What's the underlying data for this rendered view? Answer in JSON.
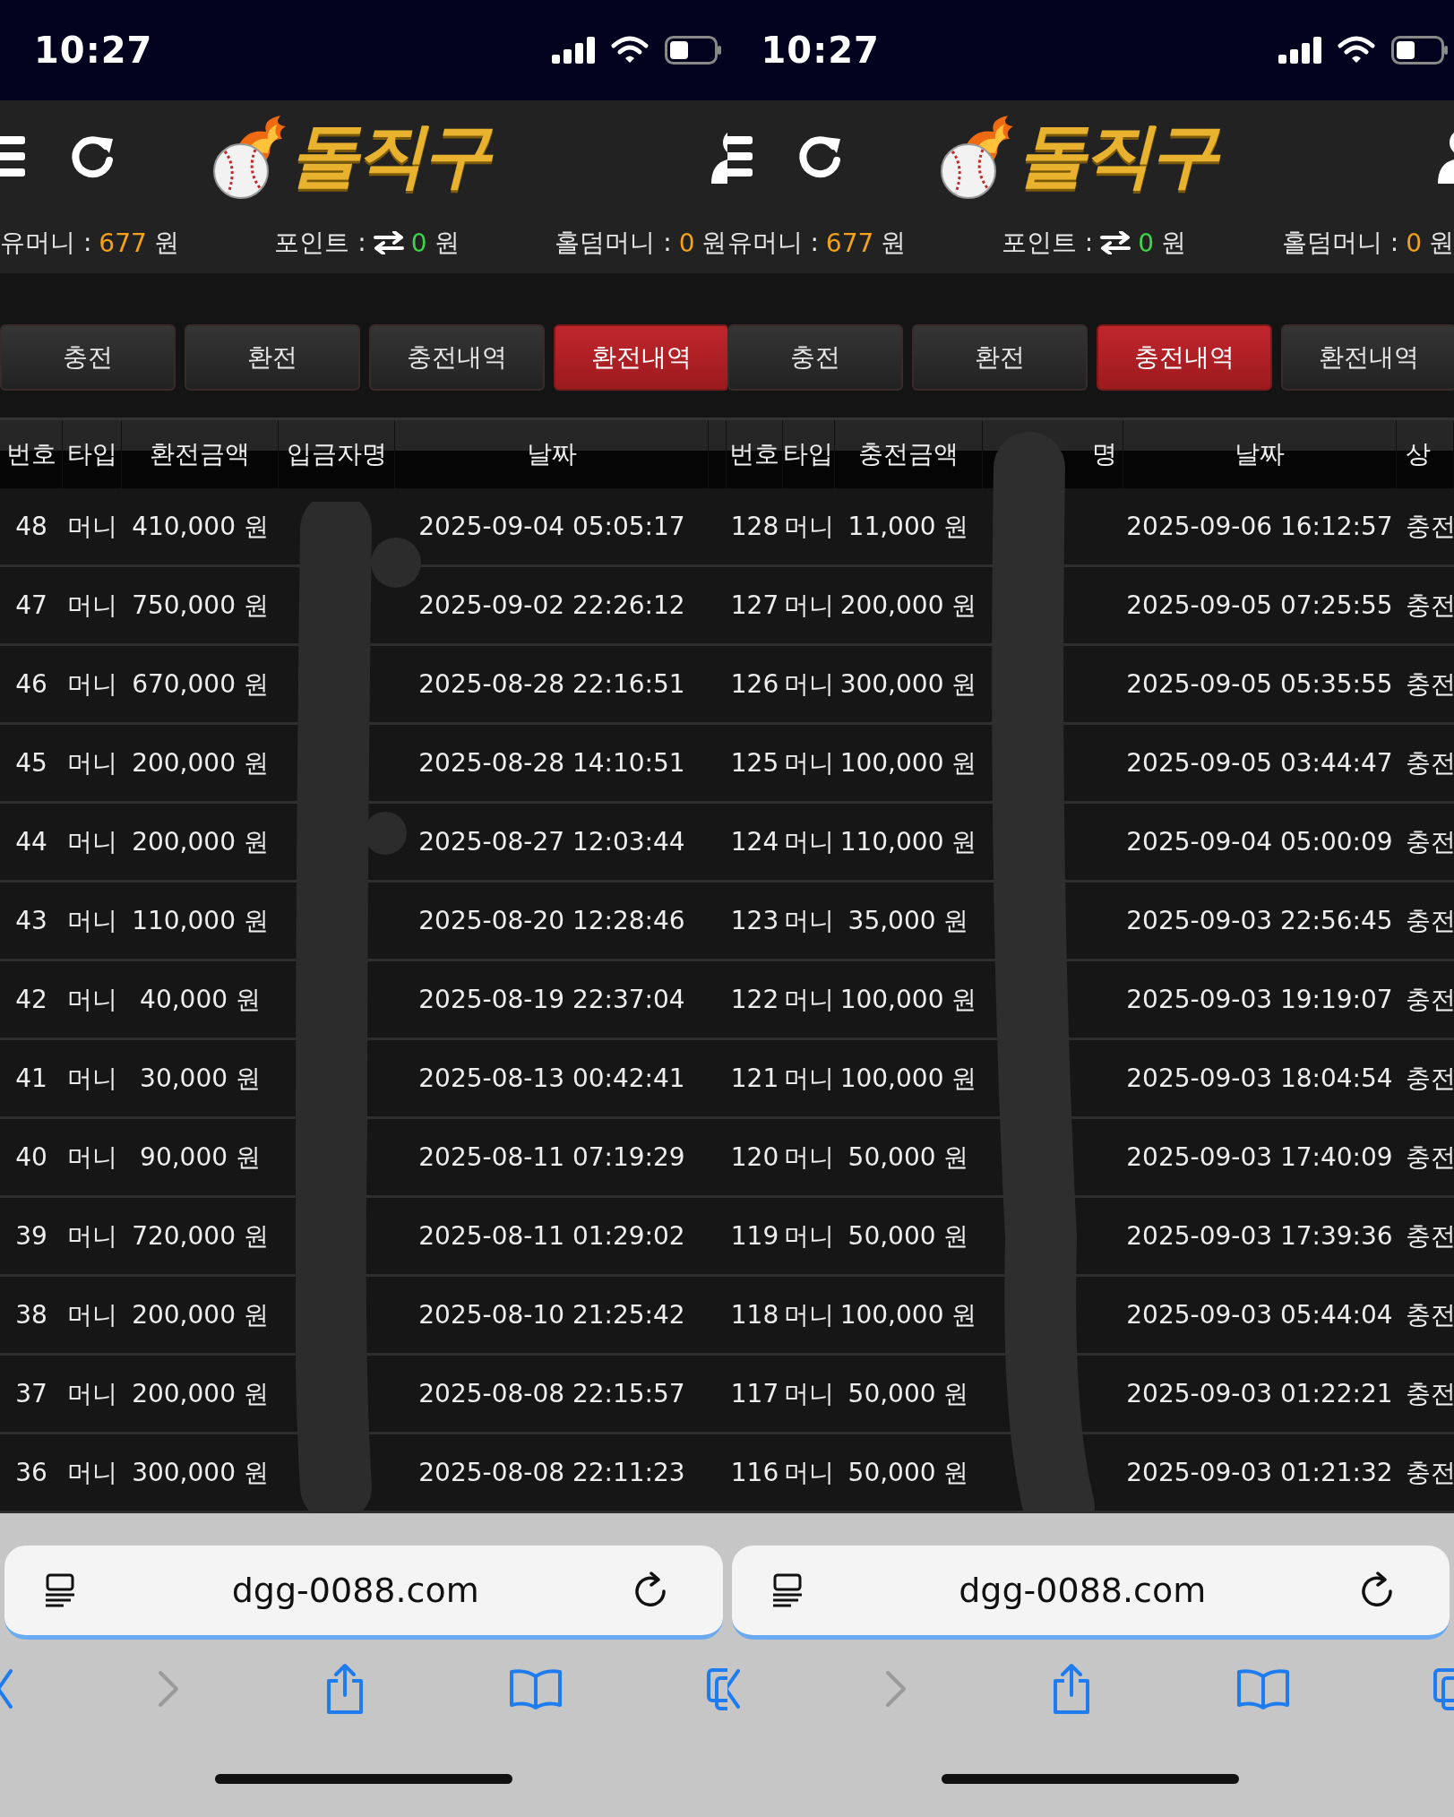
{
  "panels": [
    {
      "status_bar": {
        "time": "10:27"
      },
      "logo": {
        "text": "돌직구"
      },
      "balances": [
        {
          "kind": "money",
          "label": "유머니 :",
          "value": "677",
          "unit": "원"
        },
        {
          "kind": "point",
          "label": "포인트 :",
          "value": "0",
          "unit": "원"
        },
        {
          "kind": "money",
          "label": "홀덤머니 :",
          "value": "0",
          "unit": "원"
        }
      ],
      "tabs": [
        {
          "label": "충전",
          "selected": false
        },
        {
          "label": "환전",
          "selected": false
        },
        {
          "label": "충전내역",
          "selected": false
        },
        {
          "label": "환전내역",
          "selected": true
        }
      ],
      "table": {
        "columns": [
          "번호",
          "타입",
          "환전금액",
          "입금자명",
          "날짜"
        ],
        "rows": [
          {
            "no": "48",
            "type": "머니",
            "amount": "410,000 원",
            "date": "2025-09-04 05:05:17"
          },
          {
            "no": "47",
            "type": "머니",
            "amount": "750,000 원",
            "date": "2025-09-02 22:26:12"
          },
          {
            "no": "46",
            "type": "머니",
            "amount": "670,000 원",
            "date": "2025-08-28 22:16:51"
          },
          {
            "no": "45",
            "type": "머니",
            "amount": "200,000 원",
            "date": "2025-08-28 14:10:51"
          },
          {
            "no": "44",
            "type": "머니",
            "amount": "200,000 원",
            "date": "2025-08-27 12:03:44"
          },
          {
            "no": "43",
            "type": "머니",
            "amount": "110,000 원",
            "date": "2025-08-20 12:28:46"
          },
          {
            "no": "42",
            "type": "머니",
            "amount": "40,000 원",
            "date": "2025-08-19 22:37:04"
          },
          {
            "no": "41",
            "type": "머니",
            "amount": "30,000 원",
            "date": "2025-08-13 00:42:41"
          },
          {
            "no": "40",
            "type": "머니",
            "amount": "90,000 원",
            "date": "2025-08-11 07:19:29"
          },
          {
            "no": "39",
            "type": "머니",
            "amount": "720,000 원",
            "date": "2025-08-11 01:29:02"
          },
          {
            "no": "38",
            "type": "머니",
            "amount": "200,000 원",
            "date": "2025-08-10 21:25:42"
          },
          {
            "no": "37",
            "type": "머니",
            "amount": "200,000 원",
            "date": "2025-08-08 22:15:57"
          },
          {
            "no": "36",
            "type": "머니",
            "amount": "300,000 원",
            "date": "2025-08-08 22:11:23"
          }
        ]
      },
      "address_bar": {
        "url": "dgg-0088.com"
      },
      "toolbar": [
        {
          "kind": "back",
          "disabled": false
        },
        {
          "kind": "forward",
          "disabled": true
        },
        {
          "kind": "share",
          "disabled": false
        },
        {
          "kind": "bookmarks",
          "disabled": false
        },
        {
          "kind": "tabs",
          "disabled": false
        }
      ]
    },
    {
      "status_bar": {
        "time": "10:27"
      },
      "logo": {
        "text": "돌직구"
      },
      "balances": [
        {
          "kind": "money",
          "label": "유머니 :",
          "value": "677",
          "unit": "원"
        },
        {
          "kind": "point",
          "label": "포인트 :",
          "value": "0",
          "unit": "원"
        },
        {
          "kind": "money",
          "label": "홀덤머니 :",
          "value": "0",
          "unit": "원"
        }
      ],
      "tabs": [
        {
          "label": "충전",
          "selected": false
        },
        {
          "label": "환전",
          "selected": false
        },
        {
          "label": "충전내역",
          "selected": true
        },
        {
          "label": "환전내역",
          "selected": false
        }
      ],
      "table": {
        "columns": [
          "번호",
          "타입",
          "충전금액",
          "명",
          "날짜",
          "상"
        ],
        "rows": [
          {
            "no": "128",
            "type": "머니",
            "amount": "11,000 원",
            "date": "2025-09-06 16:12:57",
            "status": "충전"
          },
          {
            "no": "127",
            "type": "머니",
            "amount": "200,000 원",
            "date": "2025-09-05 07:25:55",
            "status": "충전"
          },
          {
            "no": "126",
            "type": "머니",
            "amount": "300,000 원",
            "date": "2025-09-05 05:35:55",
            "status": "충전"
          },
          {
            "no": "125",
            "type": "머니",
            "amount": "100,000 원",
            "date": "2025-09-05 03:44:47",
            "status": "충전"
          },
          {
            "no": "124",
            "type": "머니",
            "amount": "110,000 원",
            "date": "2025-09-04 05:00:09",
            "status": "충전"
          },
          {
            "no": "123",
            "type": "머니",
            "amount": "35,000 원",
            "date": "2025-09-03 22:56:45",
            "status": "충전"
          },
          {
            "no": "122",
            "type": "머니",
            "amount": "100,000 원",
            "date": "2025-09-03 19:19:07",
            "status": "충전"
          },
          {
            "no": "121",
            "type": "머니",
            "amount": "100,000 원",
            "date": "2025-09-03 18:04:54",
            "status": "충전"
          },
          {
            "no": "120",
            "type": "머니",
            "amount": "50,000 원",
            "date": "2025-09-03 17:40:09",
            "status": "충전"
          },
          {
            "no": "119",
            "type": "머니",
            "amount": "50,000 원",
            "date": "2025-09-03 17:39:36",
            "status": "충전"
          },
          {
            "no": "118",
            "type": "머니",
            "amount": "100,000 원",
            "date": "2025-09-03 05:44:04",
            "status": "충전"
          },
          {
            "no": "117",
            "type": "머니",
            "amount": "50,000 원",
            "date": "2025-09-03 01:22:21",
            "status": "충전"
          },
          {
            "no": "116",
            "type": "머니",
            "amount": "50,000 원",
            "date": "2025-09-03 01:21:32",
            "status": "충전"
          }
        ]
      },
      "address_bar": {
        "url": "dgg-0088.com"
      },
      "toolbar": [
        {
          "kind": "back",
          "disabled": false
        },
        {
          "kind": "forward",
          "disabled": true
        },
        {
          "kind": "share",
          "disabled": false
        },
        {
          "kind": "bookmarks",
          "disabled": false
        },
        {
          "kind": "tabs",
          "disabled": false
        }
      ]
    }
  ]
}
